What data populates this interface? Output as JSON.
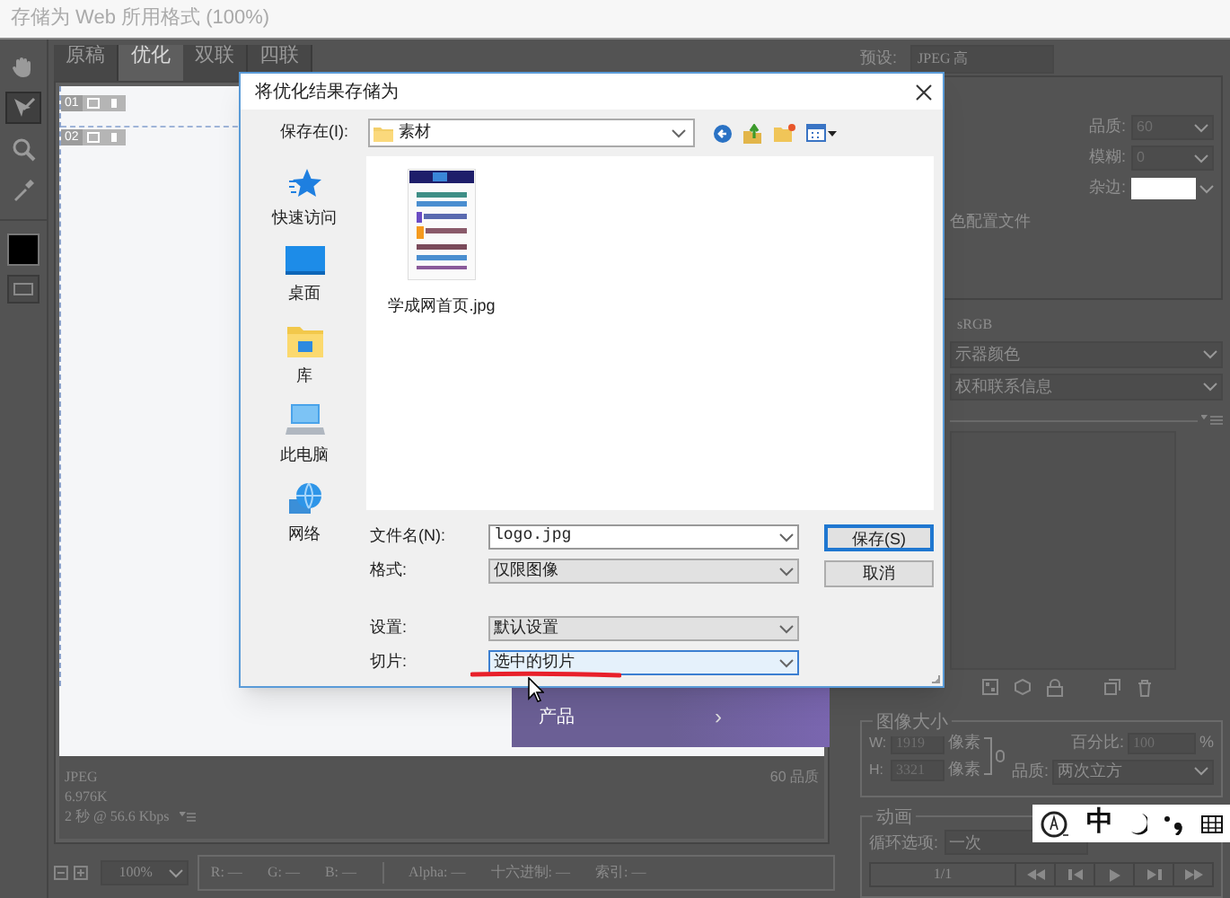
{
  "window": {
    "title": "存储为 Web 所用格式 (100%)"
  },
  "tools": [
    {
      "kind": "hand",
      "selected": false
    },
    {
      "kind": "slice-select",
      "selected": true
    },
    {
      "kind": "zoom",
      "selected": false
    },
    {
      "kind": "eyedropper",
      "selected": false
    }
  ],
  "view_tabs": [
    {
      "label": "原稿",
      "selected": false
    },
    {
      "label": "优化",
      "selected": true
    },
    {
      "label": "双联",
      "selected": false
    },
    {
      "label": "四联",
      "selected": false
    }
  ],
  "canvas": {
    "slices": [
      "01",
      "02"
    ],
    "nav_item": {
      "label": "产品",
      "arrow": "›"
    }
  },
  "optimized_info": {
    "format": "JPEG",
    "size": "6.976K",
    "time": "2 秒 @ 56.6 Kbps",
    "quality": "60 品质"
  },
  "status_bar": {
    "zoom": "100%",
    "readouts": [
      {
        "label": "R:",
        "value": "—"
      },
      {
        "label": "G:",
        "value": "—"
      },
      {
        "label": "B:",
        "value": "—"
      },
      {
        "label": "Alpha:",
        "value": "—"
      },
      {
        "label": "十六进制:",
        "value": "—"
      },
      {
        "label": "索引:",
        "value": "—"
      }
    ]
  },
  "settings_panel": {
    "preset_label": "预设:",
    "preset_value": "JPEG 高",
    "fields": [
      {
        "label": "品质:",
        "value": "60",
        "kind": "select"
      },
      {
        "label": "模糊:",
        "value": "0",
        "kind": "select"
      },
      {
        "label": "杂边:",
        "kind": "swatch"
      }
    ],
    "profile_text": "色配置文件",
    "color_space": "sRGB",
    "dropdowns": [
      "示器颜色",
      "权和联系信息"
    ]
  },
  "image_size": {
    "title": "图像大小",
    "rows": [
      {
        "label": "W:",
        "value": "1919",
        "unit": "像素"
      },
      {
        "label": "H:",
        "value": "3321",
        "unit": "像素"
      }
    ],
    "percent_label": "百分比:",
    "percent": "100",
    "percent_unit": "%",
    "quality_label": "品质:",
    "quality": "两次立方"
  },
  "animation": {
    "title": "动画",
    "loop_label": "循环选项:",
    "loop": "一次",
    "frame": "1/1"
  },
  "ime_bar": {
    "mode": "中"
  },
  "dialog": {
    "title": "将优化结果存储为",
    "save_in_label": "保存在(I):",
    "folder": "素材",
    "places": [
      {
        "label": "快速访问",
        "kind": "star"
      },
      {
        "label": "桌面",
        "kind": "desktop"
      },
      {
        "label": "库",
        "kind": "library"
      },
      {
        "label": "此电脑",
        "kind": "computer"
      },
      {
        "label": "网络",
        "kind": "network"
      }
    ],
    "files": [
      {
        "name": "学成网首页.jpg"
      }
    ],
    "fields": [
      {
        "label": "文件名(N):",
        "value": "logo.jpg",
        "kind": "input",
        "focused": false
      },
      {
        "label": "格式:",
        "value": "仅限图像",
        "kind": "select",
        "focused": false
      },
      {
        "label": "设置:",
        "value": "默认设置",
        "kind": "select",
        "focused": false
      },
      {
        "label": "切片:",
        "value": "选中的切片",
        "kind": "select",
        "focused": true
      }
    ],
    "buttons": [
      {
        "label": "保存(S)",
        "default": true
      },
      {
        "label": "取消",
        "default": false
      }
    ]
  }
}
